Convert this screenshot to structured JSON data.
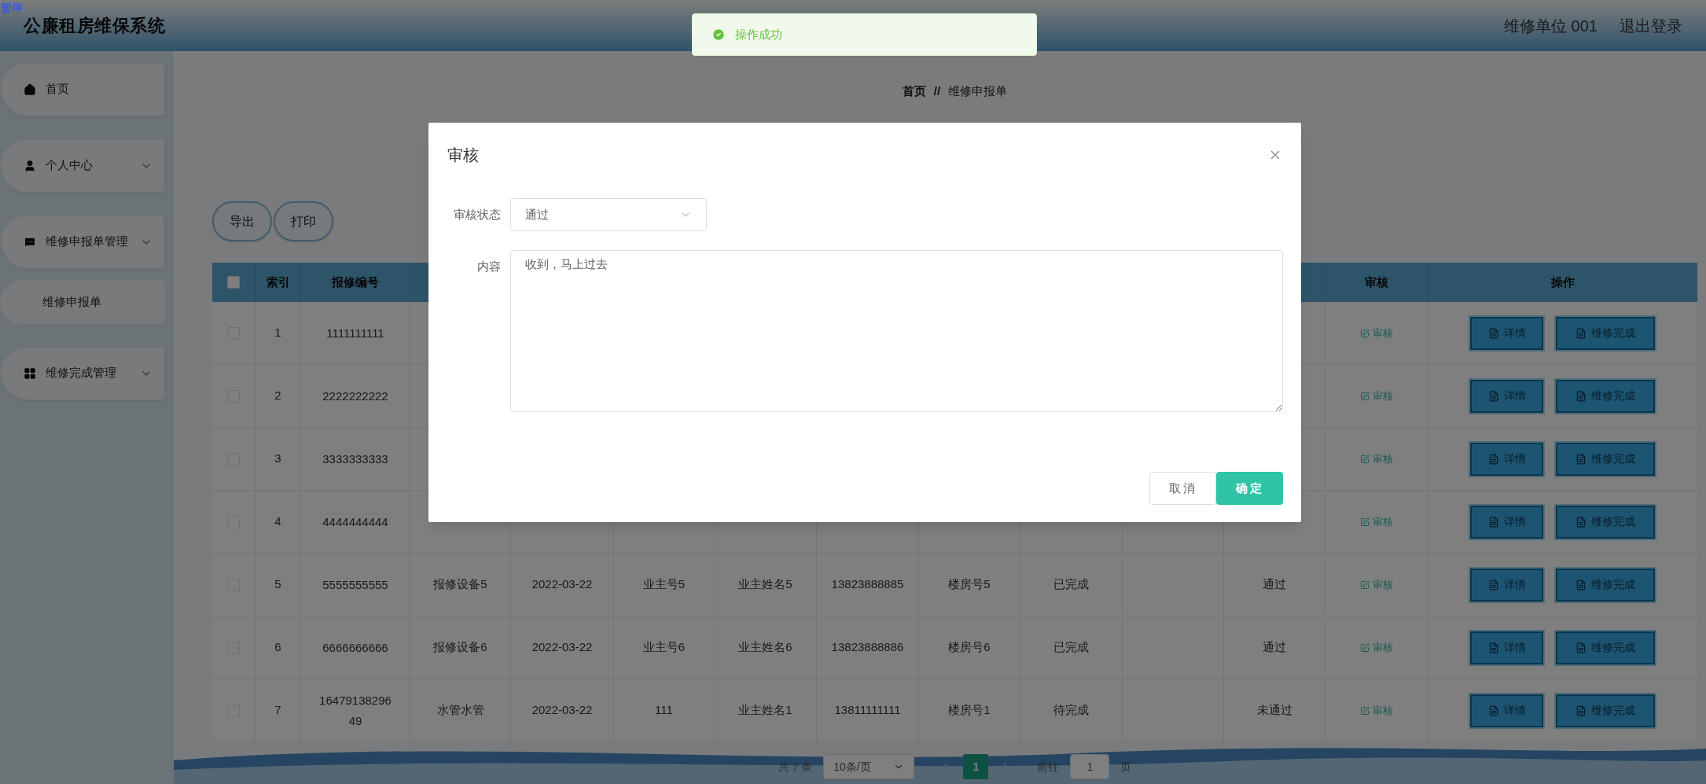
{
  "overlay_label": "暂停",
  "header": {
    "title": "公廉租房维保系统",
    "user": "维修单位 001",
    "logout": "退出登录"
  },
  "toast": {
    "kind": "success",
    "message": "操作成功"
  },
  "sidebar": {
    "items": [
      {
        "kind": "home",
        "label": "首页"
      },
      {
        "kind": "user",
        "label": "个人中心"
      },
      {
        "kind": "chat",
        "label": "维修申报单管理",
        "children": [
          {
            "label": "维修申报单"
          }
        ]
      },
      {
        "kind": "grid",
        "label": "维修完成管理"
      }
    ]
  },
  "breadcrumb": {
    "items": [
      "首页",
      "维修申报单"
    ],
    "separator": "//"
  },
  "toolbar": [
    "导出",
    "打印"
  ],
  "table": {
    "header_checked": false,
    "columns": {
      "index": "索引",
      "number": "报修编号",
      "review": "审核",
      "actions": "操作"
    },
    "rows": [
      {
        "checked": false,
        "index": "1",
        "number": "1111111111",
        "review_link": "审核",
        "actions": [
          "详情",
          "维修完成"
        ]
      },
      {
        "checked": false,
        "index": "2",
        "number": "2222222222",
        "review_link": "审核",
        "actions": [
          "详情",
          "维修完成"
        ]
      },
      {
        "checked": false,
        "index": "3",
        "number": "3333333333",
        "review_link": "审核",
        "actions": [
          "详情",
          "维修完成"
        ]
      },
      {
        "checked": false,
        "index": "4",
        "number": "4444444444",
        "review_link": "审核",
        "actions": [
          "详情",
          "维修完成"
        ]
      },
      {
        "checked": false,
        "index": "5",
        "number": "5555555555",
        "device": "报修设备5",
        "date": "2022-03-22",
        "owner_no": "业主号5",
        "owner_name": "业主姓名5",
        "phone": "13823888885",
        "building": "楼房号5",
        "status": "已完成",
        "review_status": "通过",
        "review_link": "审核",
        "actions": [
          "详情",
          "维修完成"
        ]
      },
      {
        "checked": false,
        "index": "6",
        "number": "6666666666",
        "device": "报修设备6",
        "date": "2022-03-22",
        "owner_no": "业主号6",
        "owner_name": "业主姓名6",
        "phone": "13823888886",
        "building": "楼房号6",
        "status": "已完成",
        "review_status": "通过",
        "review_link": "审核",
        "actions": [
          "详情",
          "维修完成"
        ]
      },
      {
        "checked": false,
        "index": "7",
        "number": "1647913829649",
        "device": "水管水管",
        "date": "2022-03-22",
        "owner_no": "111",
        "owner_name": "业主姓名1",
        "phone": "13811111111",
        "building": "楼房号1",
        "status": "待完成",
        "review_status": "未通过",
        "review_link": "审核",
        "actions": [
          "详情",
          "维修完成"
        ]
      }
    ]
  },
  "pagination": {
    "total": "共 7 条",
    "page_size": "10条/页",
    "pages": [
      {
        "label": "1",
        "selected": true
      }
    ],
    "goto_label": "前往",
    "goto_value": "1",
    "goto_suffix": "页"
  },
  "dialog": {
    "title": "审核",
    "fields": [
      {
        "kind": "select",
        "label": "审核状态",
        "value": "通过"
      },
      {
        "kind": "textarea",
        "label": "内容",
        "value": "收到，马上过去"
      }
    ],
    "buttons": [
      {
        "kind": "default",
        "label": "取消"
      },
      {
        "kind": "primary",
        "label": "确定"
      }
    ]
  }
}
